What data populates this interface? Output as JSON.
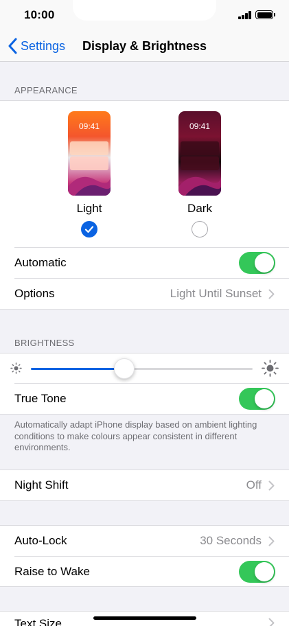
{
  "status_bar": {
    "time": "10:00"
  },
  "nav": {
    "back_label": "Settings",
    "title": "Display & Brightness"
  },
  "appearance": {
    "header": "APPEARANCE",
    "light": {
      "preview_time": "09:41",
      "label": "Light",
      "selected": true
    },
    "dark": {
      "preview_time": "09:41",
      "label": "Dark",
      "selected": false
    },
    "automatic": {
      "label": "Automatic",
      "on": true
    },
    "options": {
      "label": "Options",
      "value": "Light Until Sunset"
    }
  },
  "brightness": {
    "header": "BRIGHTNESS",
    "level": 0.42,
    "true_tone": {
      "label": "True Tone",
      "on": true
    },
    "footnote": "Automatically adapt iPhone display based on ambient lighting conditions to make colours appear consistent in different environments."
  },
  "night_shift": {
    "label": "Night Shift",
    "value": "Off"
  },
  "auto_lock": {
    "label": "Auto-Lock",
    "value": "30 Seconds"
  },
  "raise_to_wake": {
    "label": "Raise to Wake",
    "on": true
  },
  "text_size": {
    "label": "Text Size"
  },
  "colors": {
    "accent": "#0a63e2",
    "switch_on": "#34c759"
  }
}
